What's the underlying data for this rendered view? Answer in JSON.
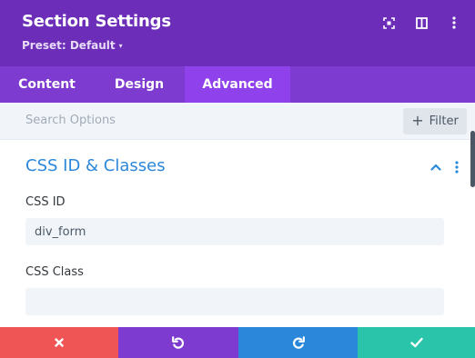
{
  "header": {
    "title": "Section Settings",
    "preset_label": "Preset: Default",
    "icons": [
      "fullscreen-icon",
      "split-view-icon",
      "more-options-icon"
    ],
    "background": "#6c2eb9"
  },
  "tabs": [
    {
      "label": "Content",
      "active": false
    },
    {
      "label": "Design",
      "active": false
    },
    {
      "label": "Advanced",
      "active": true
    }
  ],
  "search": {
    "placeholder": "Search Options",
    "filter_label": "Filter"
  },
  "section": {
    "title": "CSS ID & Classes",
    "expanded": true,
    "title_color": "#2b87da"
  },
  "fields": {
    "css_id": {
      "label": "CSS ID",
      "value": "div_form",
      "placeholder": ""
    },
    "css_class": {
      "label": "CSS Class",
      "value": "",
      "placeholder": ""
    }
  },
  "footer": {
    "buttons": [
      {
        "action": "cancel",
        "color": "#ef5555",
        "icon": "close-icon"
      },
      {
        "action": "undo",
        "color": "#7e3bd0",
        "icon": "undo-icon"
      },
      {
        "action": "redo",
        "color": "#2b87da",
        "icon": "redo-icon"
      },
      {
        "action": "save",
        "color": "#29c4a9",
        "icon": "check-icon"
      }
    ]
  }
}
